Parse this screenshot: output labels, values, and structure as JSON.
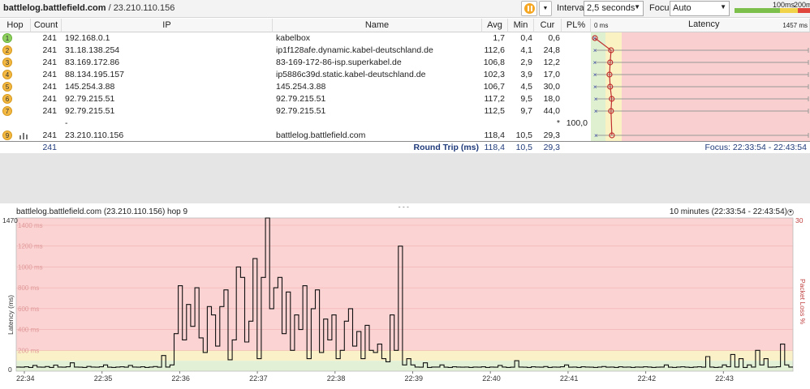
{
  "header": {
    "host": "battlelog.battlefield.com",
    "separator": " / ",
    "ip": "23.210.110.156",
    "interval_label": "Interval",
    "interval_value": "2,5 seconds",
    "focus_label": "Focus",
    "focus_value": "Auto",
    "scale_100": "100ms",
    "scale_200": "200ms"
  },
  "columns": {
    "hop": "Hop",
    "count": "Count",
    "ip": "IP",
    "name": "Name",
    "avg": "Avg",
    "min": "Min",
    "cur": "Cur",
    "pl": "PL%",
    "latency": "Latency",
    "lat_min": "0 ms",
    "lat_max": "1457 ms"
  },
  "rows": [
    {
      "hop": "1",
      "color": "green",
      "count": "241",
      "ip": "192.168.0.1",
      "name": "kabelbox",
      "avg": "1,7",
      "min": "0,4",
      "cur": "0,6",
      "pl": ""
    },
    {
      "hop": "2",
      "color": "orange",
      "count": "241",
      "ip": "31.18.138.254",
      "name": "ip1f128afe.dynamic.kabel-deutschland.de",
      "avg": "112,6",
      "min": "4,1",
      "cur": "24,8",
      "pl": ""
    },
    {
      "hop": "3",
      "color": "orange",
      "count": "241",
      "ip": "83.169.172.86",
      "name": "83-169-172-86-isp.superkabel.de",
      "avg": "106,8",
      "min": "2,9",
      "cur": "12,2",
      "pl": ""
    },
    {
      "hop": "4",
      "color": "orange",
      "count": "241",
      "ip": "88.134.195.157",
      "name": "ip5886c39d.static.kabel-deutschland.de",
      "avg": "102,3",
      "min": "3,9",
      "cur": "17,0",
      "pl": ""
    },
    {
      "hop": "5",
      "color": "orange",
      "count": "241",
      "ip": "145.254.3.88",
      "name": "145.254.3.88",
      "avg": "106,7",
      "min": "4,5",
      "cur": "30,0",
      "pl": ""
    },
    {
      "hop": "6",
      "color": "orange",
      "count": "241",
      "ip": "92.79.215.51",
      "name": "92.79.215.51",
      "avg": "117,2",
      "min": "9,5",
      "cur": "18,0",
      "pl": ""
    },
    {
      "hop": "7",
      "color": "orange",
      "count": "241",
      "ip": "92.79.215.51",
      "name": "92.79.215.51",
      "avg": "112,5",
      "min": "9,7",
      "cur": "44,0",
      "pl": ""
    },
    {
      "hop": "",
      "color": "",
      "count": "",
      "ip": "-",
      "name": "",
      "avg": "",
      "min": "",
      "cur": "*",
      "pl": "100,0"
    },
    {
      "hop": "9",
      "color": "orange",
      "count": "241",
      "ip": "23.210.110.156",
      "name": "battlelog.battlefield.com",
      "avg": "118,4",
      "min": "10,5",
      "cur": "29,3",
      "pl": ""
    }
  ],
  "footer": {
    "count": "241",
    "label": "Round Trip (ms)",
    "avg": "118,4",
    "min": "10,5",
    "cur": "29,3",
    "focus": "Focus: 22:33:54 - 22:43:54"
  },
  "graph": {
    "title": "battlelog.battlefield.com (23.210.110.156) hop 9",
    "range": "10 minutes (22:33:54 - 22:43:54)",
    "y_label": "Latency (ms)",
    "y2_label": "Packet Loss %",
    "y_max_label": "1470",
    "y_zero_label": "0",
    "y2_max_label": "30",
    "y_gridlabels": [
      "1400 ms",
      "1200 ms",
      "1000 ms",
      "800 ms",
      "600 ms",
      "400 ms",
      "200 ms"
    ],
    "x_ticks": [
      "22:34",
      "22:35",
      "22:36",
      "22:37",
      "22:38",
      "22:39",
      "22:40",
      "22:41",
      "22:42",
      "22:43"
    ]
  },
  "chart_data": {
    "type": "line",
    "title": "",
    "xlabel": "",
    "ylabel": "Latency (ms)",
    "ylim": [
      0,
      1470
    ],
    "series": [
      {
        "name": "",
        "values": [
          40,
          38,
          42,
          36,
          55,
          40,
          38,
          44,
          36,
          58,
          40,
          38,
          42,
          80,
          40,
          38,
          36,
          45,
          40,
          38,
          42,
          60,
          38,
          36,
          40,
          42,
          38,
          55,
          40,
          38,
          42,
          36,
          40,
          44,
          38,
          150,
          40,
          60,
          360,
          820,
          300,
          640,
          430,
          800,
          320,
          180,
          620,
          540,
          240,
          620,
          780,
          110,
          300,
          1000,
          900,
          280,
          480,
          1080,
          120,
          900,
          1470,
          600,
          800,
          900,
          360,
          760,
          200,
          540,
          400,
          820,
          120,
          600,
          780,
          180,
          500,
          300,
          540,
          120,
          200,
          480,
          600,
          240,
          380,
          120,
          440,
          200,
          180,
          260,
          120,
          90,
          540,
          200,
          1200,
          60,
          120,
          60,
          40,
          38,
          80,
          36,
          40,
          40,
          60,
          38,
          36,
          42,
          40,
          38,
          40,
          36,
          40,
          38,
          42,
          36,
          40,
          38,
          55,
          40,
          36,
          38,
          100,
          40,
          38,
          36,
          42,
          40,
          38,
          44,
          36,
          40,
          38,
          42,
          60,
          38,
          40,
          36,
          42,
          40,
          38,
          36,
          40,
          44,
          38,
          40,
          36,
          42,
          38,
          40,
          36,
          40,
          38,
          42,
          40,
          36,
          38,
          40,
          60,
          38,
          36,
          40,
          42,
          38,
          36,
          40,
          42,
          38,
          140,
          40,
          36,
          38,
          60,
          42,
          160,
          40,
          120,
          36,
          60,
          40,
          200,
          60,
          120,
          38,
          40,
          42,
          260,
          60,
          40
        ]
      }
    ]
  }
}
